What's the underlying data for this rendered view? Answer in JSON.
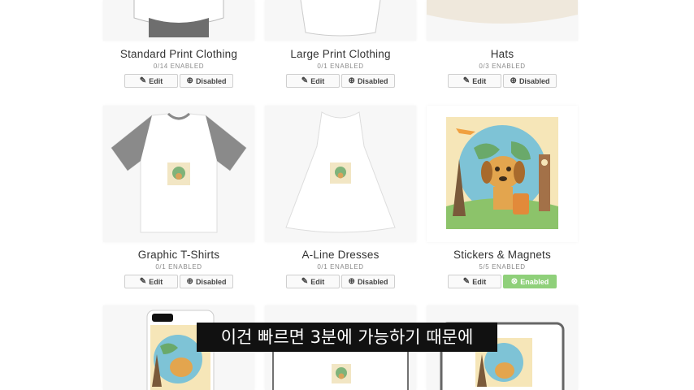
{
  "cards": [
    {
      "title": "Standard Print Clothing",
      "count": "0/14 ENABLED",
      "edit": "Edit",
      "state": "Disabled"
    },
    {
      "title": "Large Print Clothing",
      "count": "0/1 ENABLED",
      "edit": "Edit",
      "state": "Disabled"
    },
    {
      "title": "Hats",
      "count": "0/3 ENABLED",
      "edit": "Edit",
      "state": "Disabled"
    },
    {
      "title": "Graphic T-Shirts",
      "count": "0/1 ENABLED",
      "edit": "Edit",
      "state": "Disabled"
    },
    {
      "title": "A-Line Dresses",
      "count": "0/1 ENABLED",
      "edit": "Edit",
      "state": "Disabled"
    },
    {
      "title": "Stickers & Magnets",
      "count": "5/5 ENABLED",
      "edit": "Edit",
      "state": "Enabled"
    }
  ],
  "icons": {
    "edit": "edit-icon",
    "disabled": "plus-circle-icon",
    "enabled": "x-circle-icon"
  },
  "colors": {
    "enabled_bg": "#8fd07a",
    "button_border": "#cfcfcf",
    "subtitle_bg": "#111111"
  },
  "subtitle": "이건 빠르면 3분에 가능하기 때문에"
}
